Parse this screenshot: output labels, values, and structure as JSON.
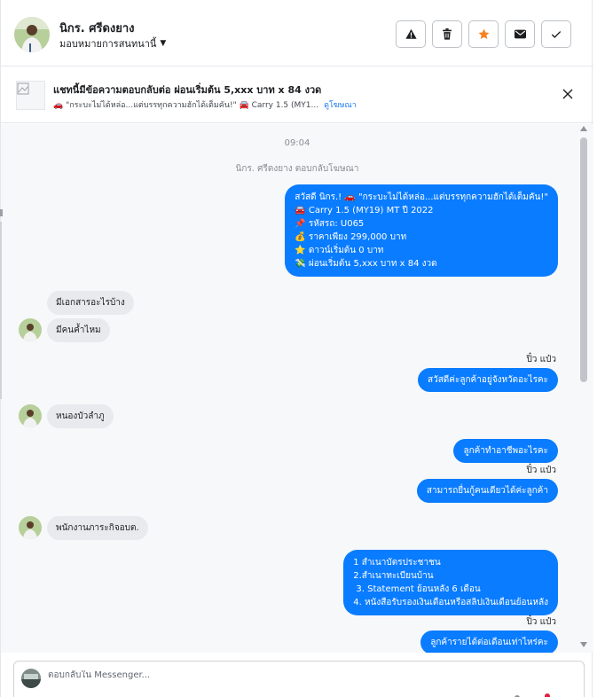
{
  "header": {
    "name": "นิกร. ศรีดงยาง",
    "assign_label": "มอบหมายการสนทนานี้",
    "actions": [
      "warning-icon",
      "trash-icon",
      "star-icon",
      "envelope-icon",
      "check-icon"
    ],
    "star_color": "#f5821f"
  },
  "ad": {
    "title": "แชทนี้มีข้อความตอบกลับต่อ ผ่อนเริ่มต้น 5,xxx บาท x 84 งวด",
    "subtitle": "🚗 \"กระบะไม่ได้หล่อ...แต่บรรทุกความฮักได้เต็มคัน!\" 🚘 Carry 1.5 (MY1...",
    "link": "ดูโฆษณา"
  },
  "chat": {
    "time": "09:04",
    "reply_notice": "นิกร. ศรีดงยาง ตอบกลับโฆษณา",
    "ad_message_lines": [
      "สวัสดี นิกร.! 🚗 \"กระบะไม่ได้หล่อ...แต่บรรทุกความฮักได้เต็มคัน!\"",
      "🚘 Carry 1.5 (MY19) MT ปี 2022",
      "📌 รหัสรถ: U065",
      "💰 ราคาเพียง 299,000 บาท",
      "⭐ ดาวน์เริ่มต้น 0 บาท",
      "💸 ผ่อนเริ่มต้น 5,xxx บาท x 84 งวด"
    ],
    "in_1": "มีเอกสารอะไรบ้าง",
    "in_2": "มีคนค้ำไหม",
    "sender_1": "ปิ๋ว แป๋ว",
    "out_1": "สวัสดีค่ะลูกค้าอยู่จังหวัดอะไรคะ",
    "in_3": "หนองบัวลำภู",
    "out_2": "ลูกค้าทำอาชีพอะไรคะ",
    "sender_2": "ปิ๋ว แป๋ว",
    "out_3": "สามารถยื่นกู้คนเดียวได้ค่ะลูกค้า",
    "in_4": "พนักงานภาระกิจอบต.",
    "docs_lines": [
      "1 สำเนาบัตรประชาชน",
      "2.สำเนาทะเบียนบ้าน",
      " 3. Statement ย้อนหลัง 6 เดือน",
      "4. หนังสือรับรองเงินเดือนหรือสลิปเงินเดือนย้อนหลัง"
    ],
    "sender_3": "ปิ๋ว แป๋ว",
    "out_4": "ลูกค้ารายได้ต่อเดือนเท่าไหร่คะ",
    "bubble_out_color": "#0a7cff",
    "bubble_in_color": "#e9eaed"
  },
  "composer": {
    "placeholder": "ตอบกลับใน Messenger..."
  }
}
